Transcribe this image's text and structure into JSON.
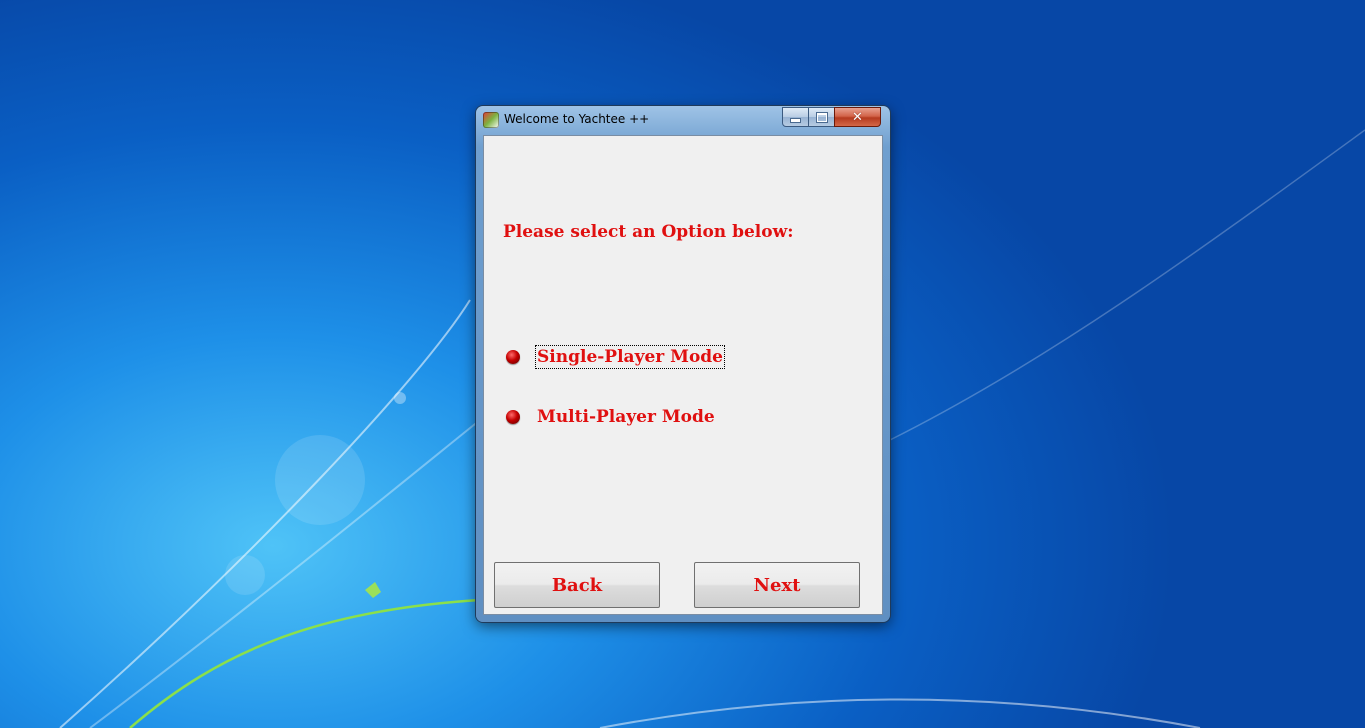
{
  "window": {
    "title": "Welcome to Yachtee ++",
    "app_icon": "yachtee-app-icon",
    "controls": {
      "minimize": "minimize-icon",
      "maximize": "maximize-icon",
      "close": "close-icon"
    }
  },
  "content": {
    "heading": "Please select an Option below:",
    "options": [
      {
        "label": "Single-Player Mode",
        "icon": "radio-bullet-icon"
      },
      {
        "label": "Multi-Player Mode",
        "icon": "radio-bullet-icon"
      }
    ],
    "buttons": {
      "back": "Back",
      "next": "Next"
    }
  },
  "colors": {
    "text_accent": "#e01010",
    "client_bg": "#f0f0f0",
    "desktop_bg": "#1e90e8"
  }
}
